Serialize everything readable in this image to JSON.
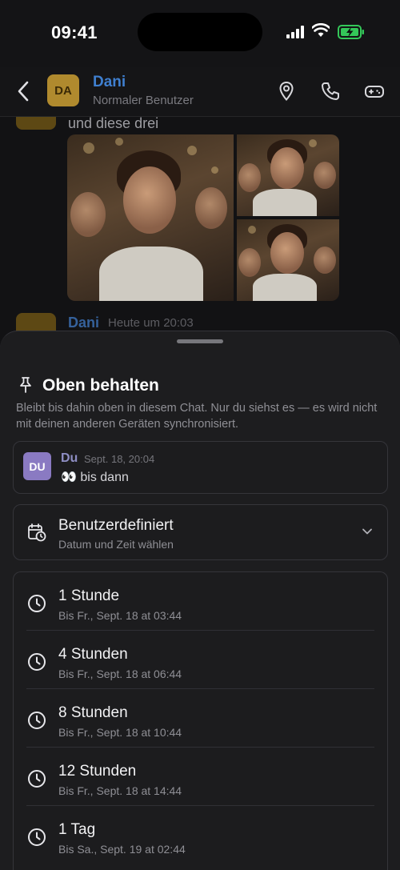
{
  "status_bar": {
    "time": "09:41"
  },
  "header": {
    "avatar_initials": "DA",
    "name": "Dani",
    "subtitle": "Normaler Benutzer"
  },
  "chat": {
    "message_text": "und diese drei",
    "second_message": {
      "sender": "Dani",
      "time": "Heute um 20:03"
    }
  },
  "sheet": {
    "title": "Oben behalten",
    "description": "Bleibt bis dahin oben in diesem Chat. Nur du siehst es — es wird nicht mit deinen anderen Geräten synchronisiert.",
    "preview": {
      "avatar_initials": "DU",
      "sender": "Du",
      "time": "Sept. 18, 20:04",
      "message": "👀 bis dann"
    },
    "custom": {
      "title": "Benutzerdefiniert",
      "subtitle": "Datum und Zeit wählen"
    },
    "options": [
      {
        "title": "1 Stunde",
        "until": "Bis Fr., Sept. 18 at 03:44"
      },
      {
        "title": "4 Stunden",
        "until": "Bis Fr., Sept. 18 at 06:44"
      },
      {
        "title": "8 Stunden",
        "until": "Bis Fr., Sept. 18 at 10:44"
      },
      {
        "title": "12 Stunden",
        "until": "Bis Fr., Sept. 18 at 14:44"
      },
      {
        "title": "1 Tag",
        "until": "Bis Sa., Sept. 19 at 02:44"
      }
    ]
  },
  "colors": {
    "accent_name": "#3f7fcf",
    "battery_green": "#34c759"
  }
}
